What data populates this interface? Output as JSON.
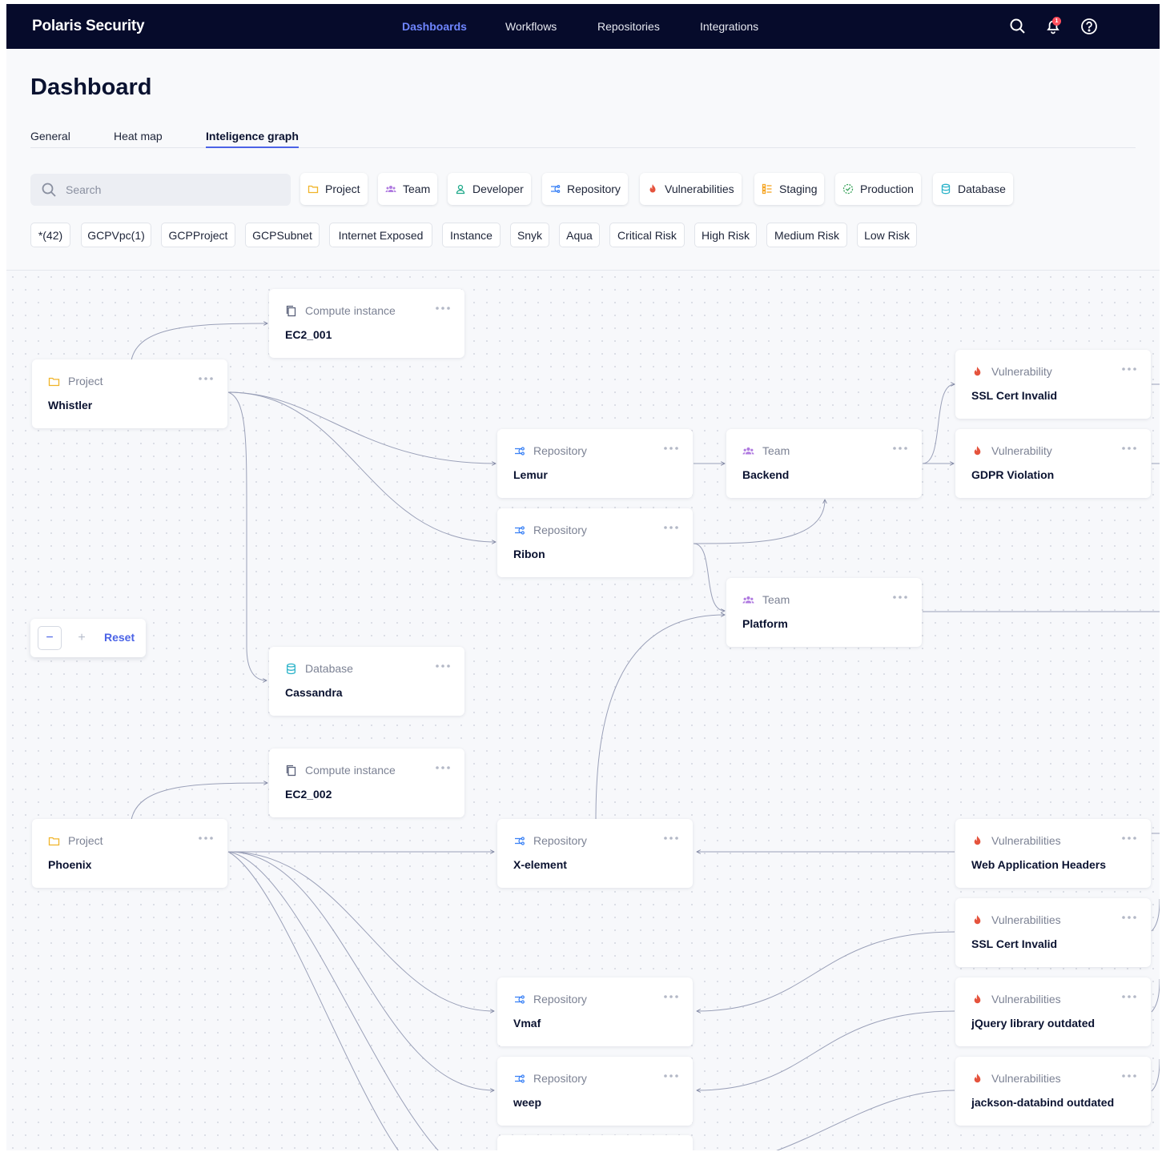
{
  "app": {
    "brand": "Polaris Security",
    "nav": [
      "Dashboards",
      "Workflows",
      "Repositories",
      "Integrations"
    ],
    "notifications_count": "1"
  },
  "page": {
    "title": "Dashboard",
    "tabs": [
      "General",
      "Heat map",
      "Inteligence graph"
    ],
    "active_tab": "Inteligence graph"
  },
  "search": {
    "placeholder": "Search",
    "value": ""
  },
  "type_filters": [
    "Project",
    "Team",
    "Developer",
    "Repository",
    "Vulnerabilities",
    "Staging",
    "Production",
    "Database"
  ],
  "tag_filters": [
    "*(42)",
    "GCPVpc(1)",
    "GCPProject",
    "GCPSubnet",
    "Internet Exposed",
    "Instance",
    "Snyk",
    "Aqua",
    "Critical Risk",
    "High Risk",
    "Medium Risk",
    "Low Risk"
  ],
  "colors": {
    "nav_bg": "#060b2b",
    "accent": "#4b63e6",
    "nav_active": "#6f86ff",
    "project": "#f0b429",
    "team": "#b07be0",
    "developer": "#1fa98a",
    "repository": "#3b82f6",
    "vulnerability": "#e5533d",
    "staging": "#f5a524",
    "production": "#3aa35b",
    "database": "#2bb3c9",
    "edge": "#9aa0b8"
  },
  "graph": {
    "nodes": [
      {
        "id": "ec2_001",
        "type": "Compute instance",
        "icon": "copy-icon",
        "name": "EC2_001"
      },
      {
        "id": "whistler",
        "type": "Project",
        "icon": "folder-icon",
        "name": "Whistler"
      },
      {
        "id": "lemur",
        "type": "Repository",
        "icon": "repository-icon",
        "name": "Lemur"
      },
      {
        "id": "ribon",
        "type": "Repository",
        "icon": "repository-icon",
        "name": "Ribon"
      },
      {
        "id": "backend",
        "type": "Team",
        "icon": "team-icon",
        "name": "Backend"
      },
      {
        "id": "platform",
        "type": "Team",
        "icon": "team-icon",
        "name": "Platform"
      },
      {
        "id": "ssl1",
        "type": "Vulnerability",
        "icon": "flame-icon",
        "name": "SSL Cert Invalid"
      },
      {
        "id": "gdpr",
        "type": "Vulnerability",
        "icon": "flame-icon",
        "name": "GDPR Violation"
      },
      {
        "id": "cassandra",
        "type": "Database",
        "icon": "database-icon",
        "name": "Cassandra"
      },
      {
        "id": "ec2_002",
        "type": "Compute instance",
        "icon": "copy-icon",
        "name": "EC2_002"
      },
      {
        "id": "phoenix",
        "type": "Project",
        "icon": "folder-icon",
        "name": "Phoenix"
      },
      {
        "id": "xelement",
        "type": "Repository",
        "icon": "repository-icon",
        "name": "X-element"
      },
      {
        "id": "vmaf",
        "type": "Repository",
        "icon": "repository-icon",
        "name": "Vmaf"
      },
      {
        "id": "weep",
        "type": "Repository",
        "icon": "repository-icon",
        "name": "weep"
      },
      {
        "id": "webheaders",
        "type": "Vulnerabilities",
        "icon": "flame-icon",
        "name": "Web Application Headers"
      },
      {
        "id": "ssl2",
        "type": "Vulnerabilities",
        "icon": "flame-icon",
        "name": "SSL Cert Invalid"
      },
      {
        "id": "jquery",
        "type": "Vulnerabilities",
        "icon": "flame-icon",
        "name": "jQuery library outdated"
      },
      {
        "id": "jackson",
        "type": "Vulnerabilities",
        "icon": "flame-icon",
        "name": "jackson-databind outdated"
      }
    ],
    "edges": [
      [
        "whistler",
        "ec2_001"
      ],
      [
        "whistler",
        "lemur"
      ],
      [
        "whistler",
        "ribon"
      ],
      [
        "whistler",
        "cassandra"
      ],
      [
        "lemur",
        "backend"
      ],
      [
        "ribon",
        "backend"
      ],
      [
        "ribon",
        "platform"
      ],
      [
        "backend",
        "ssl1"
      ],
      [
        "backend",
        "gdpr"
      ],
      [
        "xelement",
        "platform"
      ],
      [
        "phoenix",
        "ec2_002"
      ],
      [
        "phoenix",
        "xelement"
      ],
      [
        "phoenix",
        "vmaf"
      ],
      [
        "phoenix",
        "weep"
      ],
      [
        "webheaders",
        "xelement"
      ],
      [
        "ssl2",
        "vmaf"
      ],
      [
        "jquery",
        "weep"
      ]
    ]
  },
  "zoom": {
    "minus": "−",
    "plus": "+",
    "reset": "Reset"
  }
}
